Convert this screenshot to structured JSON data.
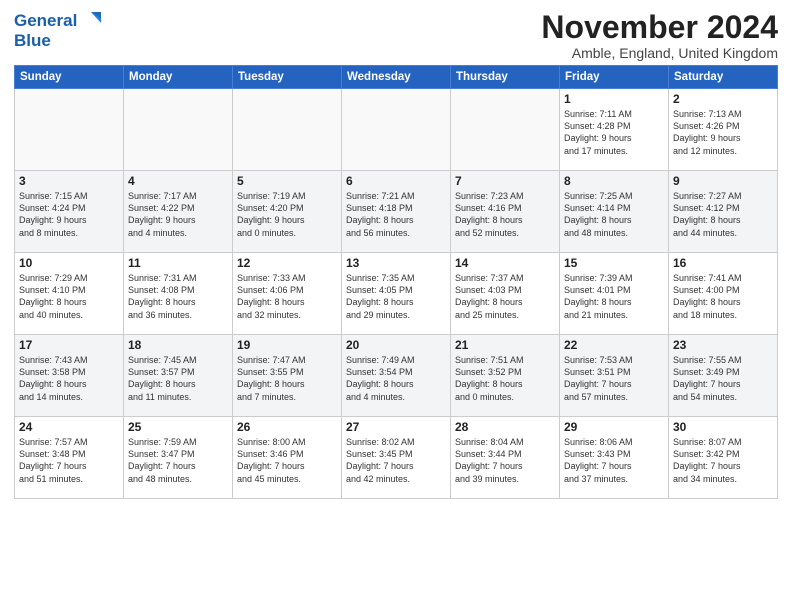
{
  "logo": {
    "line1": "General",
    "line2": "Blue"
  },
  "title": "November 2024",
  "subtitle": "Amble, England, United Kingdom",
  "days_of_week": [
    "Sunday",
    "Monday",
    "Tuesday",
    "Wednesday",
    "Thursday",
    "Friday",
    "Saturday"
  ],
  "weeks": [
    [
      {
        "day": "",
        "info": ""
      },
      {
        "day": "",
        "info": ""
      },
      {
        "day": "",
        "info": ""
      },
      {
        "day": "",
        "info": ""
      },
      {
        "day": "",
        "info": ""
      },
      {
        "day": "1",
        "info": "Sunrise: 7:11 AM\nSunset: 4:28 PM\nDaylight: 9 hours\nand 17 minutes."
      },
      {
        "day": "2",
        "info": "Sunrise: 7:13 AM\nSunset: 4:26 PM\nDaylight: 9 hours\nand 12 minutes."
      }
    ],
    [
      {
        "day": "3",
        "info": "Sunrise: 7:15 AM\nSunset: 4:24 PM\nDaylight: 9 hours\nand 8 minutes."
      },
      {
        "day": "4",
        "info": "Sunrise: 7:17 AM\nSunset: 4:22 PM\nDaylight: 9 hours\nand 4 minutes."
      },
      {
        "day": "5",
        "info": "Sunrise: 7:19 AM\nSunset: 4:20 PM\nDaylight: 9 hours\nand 0 minutes."
      },
      {
        "day": "6",
        "info": "Sunrise: 7:21 AM\nSunset: 4:18 PM\nDaylight: 8 hours\nand 56 minutes."
      },
      {
        "day": "7",
        "info": "Sunrise: 7:23 AM\nSunset: 4:16 PM\nDaylight: 8 hours\nand 52 minutes."
      },
      {
        "day": "8",
        "info": "Sunrise: 7:25 AM\nSunset: 4:14 PM\nDaylight: 8 hours\nand 48 minutes."
      },
      {
        "day": "9",
        "info": "Sunrise: 7:27 AM\nSunset: 4:12 PM\nDaylight: 8 hours\nand 44 minutes."
      }
    ],
    [
      {
        "day": "10",
        "info": "Sunrise: 7:29 AM\nSunset: 4:10 PM\nDaylight: 8 hours\nand 40 minutes."
      },
      {
        "day": "11",
        "info": "Sunrise: 7:31 AM\nSunset: 4:08 PM\nDaylight: 8 hours\nand 36 minutes."
      },
      {
        "day": "12",
        "info": "Sunrise: 7:33 AM\nSunset: 4:06 PM\nDaylight: 8 hours\nand 32 minutes."
      },
      {
        "day": "13",
        "info": "Sunrise: 7:35 AM\nSunset: 4:05 PM\nDaylight: 8 hours\nand 29 minutes."
      },
      {
        "day": "14",
        "info": "Sunrise: 7:37 AM\nSunset: 4:03 PM\nDaylight: 8 hours\nand 25 minutes."
      },
      {
        "day": "15",
        "info": "Sunrise: 7:39 AM\nSunset: 4:01 PM\nDaylight: 8 hours\nand 21 minutes."
      },
      {
        "day": "16",
        "info": "Sunrise: 7:41 AM\nSunset: 4:00 PM\nDaylight: 8 hours\nand 18 minutes."
      }
    ],
    [
      {
        "day": "17",
        "info": "Sunrise: 7:43 AM\nSunset: 3:58 PM\nDaylight: 8 hours\nand 14 minutes."
      },
      {
        "day": "18",
        "info": "Sunrise: 7:45 AM\nSunset: 3:57 PM\nDaylight: 8 hours\nand 11 minutes."
      },
      {
        "day": "19",
        "info": "Sunrise: 7:47 AM\nSunset: 3:55 PM\nDaylight: 8 hours\nand 7 minutes."
      },
      {
        "day": "20",
        "info": "Sunrise: 7:49 AM\nSunset: 3:54 PM\nDaylight: 8 hours\nand 4 minutes."
      },
      {
        "day": "21",
        "info": "Sunrise: 7:51 AM\nSunset: 3:52 PM\nDaylight: 8 hours\nand 0 minutes."
      },
      {
        "day": "22",
        "info": "Sunrise: 7:53 AM\nSunset: 3:51 PM\nDaylight: 7 hours\nand 57 minutes."
      },
      {
        "day": "23",
        "info": "Sunrise: 7:55 AM\nSunset: 3:49 PM\nDaylight: 7 hours\nand 54 minutes."
      }
    ],
    [
      {
        "day": "24",
        "info": "Sunrise: 7:57 AM\nSunset: 3:48 PM\nDaylight: 7 hours\nand 51 minutes."
      },
      {
        "day": "25",
        "info": "Sunrise: 7:59 AM\nSunset: 3:47 PM\nDaylight: 7 hours\nand 48 minutes."
      },
      {
        "day": "26",
        "info": "Sunrise: 8:00 AM\nSunset: 3:46 PM\nDaylight: 7 hours\nand 45 minutes."
      },
      {
        "day": "27",
        "info": "Sunrise: 8:02 AM\nSunset: 3:45 PM\nDaylight: 7 hours\nand 42 minutes."
      },
      {
        "day": "28",
        "info": "Sunrise: 8:04 AM\nSunset: 3:44 PM\nDaylight: 7 hours\nand 39 minutes."
      },
      {
        "day": "29",
        "info": "Sunrise: 8:06 AM\nSunset: 3:43 PM\nDaylight: 7 hours\nand 37 minutes."
      },
      {
        "day": "30",
        "info": "Sunrise: 8:07 AM\nSunset: 3:42 PM\nDaylight: 7 hours\nand 34 minutes."
      }
    ]
  ]
}
